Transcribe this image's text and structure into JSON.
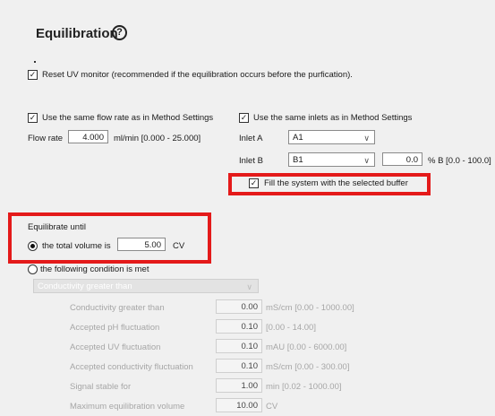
{
  "header": {
    "title": "Equilibration",
    "help_icon": "?"
  },
  "reset_uv": {
    "checked": true,
    "label": "Reset UV monitor (recommended if the equilibration occurs before the purfication)."
  },
  "flow": {
    "same_rate_label": "Use the same flow rate as in Method Settings",
    "flow_rate_label": "Flow rate",
    "flow_rate_value": "4.000",
    "flow_rate_unit": "ml/min  [0.000 - 25.000]"
  },
  "inlets": {
    "same_inlets_label": "Use the same inlets as in Method Settings",
    "inlet_a_label": "Inlet A",
    "inlet_a_value": "A1",
    "inlet_b_label": "Inlet B",
    "inlet_b_value": "B1",
    "percent_b_value": "0.0",
    "percent_b_unit": "% B [0.0 - 100.0]",
    "fill_label": "Fill the system with the selected buffer"
  },
  "equilibrate": {
    "heading": "Equilibrate until",
    "option_volume_label": "the total volume is",
    "volume_value": "5.00",
    "volume_unit": "CV",
    "option_condition_label": "the following condition is met",
    "condition_select": "Conductivity greater than",
    "conditions": [
      {
        "label": "Conductivity greater than",
        "value": "0.00",
        "unit": "mS/cm  [0.00 - 1000.00]"
      },
      {
        "label": "Accepted pH fluctuation",
        "value": "0.10",
        "unit": "[0.00 - 14.00]"
      },
      {
        "label": "Accepted UV fluctuation",
        "value": "0.10",
        "unit": "mAU  [0.00 - 6000.00]"
      },
      {
        "label": "Accepted conductivity fluctuation",
        "value": "0.10",
        "unit": "mS/cm  [0.00 - 300.00]"
      },
      {
        "label": "Signal stable for",
        "value": "1.00",
        "unit": "min   [0.02 - 1000.00]"
      },
      {
        "label": "Maximum equilibration volume",
        "value": "10.00",
        "unit": "CV"
      }
    ]
  },
  "colors": {
    "highlight": "#e41a1a",
    "background": "#f0f0f0"
  }
}
